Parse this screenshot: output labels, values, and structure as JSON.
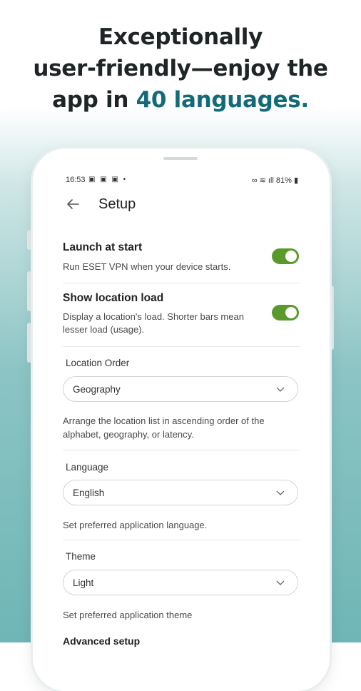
{
  "headline": {
    "line1": "Exceptionally",
    "line2": "user-friendly—enjoy the",
    "line3_prefix": "app in ",
    "line3_accent": "40 languages."
  },
  "status_bar": {
    "time": "16:53",
    "left_icons": "▣ ▣ ▣ •",
    "right_icons": "∞ ≋ ıll 81% ▮"
  },
  "screen": {
    "title": "Setup",
    "back_icon": "arrow-left-icon"
  },
  "settings": {
    "launch": {
      "title": "Launch at start",
      "desc": "Run ESET VPN when your device starts."
    },
    "location_load": {
      "title": "Show location load",
      "desc": "Display a location's load. Shorter bars mean lesser load (usage)."
    },
    "location_order": {
      "label": "Location Order",
      "value": "Geography",
      "help": "Arrange the location list in ascending order of the alphabet, geography, or latency."
    },
    "language": {
      "label": "Language",
      "value": "English",
      "help": "Set preferred application language."
    },
    "theme": {
      "label": "Theme",
      "value": "Light",
      "help": "Set preferred application theme"
    },
    "advanced": {
      "title": "Advanced setup"
    }
  },
  "colors": {
    "accent": "#136a78",
    "toggle_on": "#5a9a2a"
  }
}
